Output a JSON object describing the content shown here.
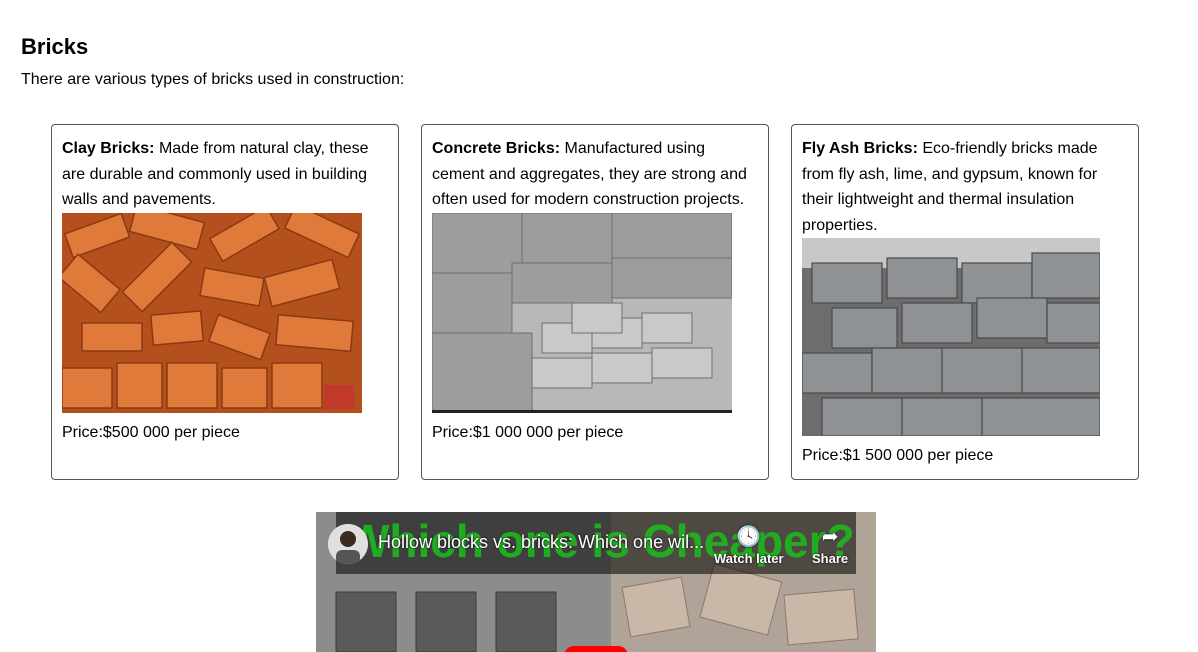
{
  "section": {
    "title": "Bricks",
    "intro": "There are various types of bricks used in construction:"
  },
  "cards": [
    {
      "name": "Clay Bricks:",
      "description": " Made from natural clay, these are durable and commonly used in building walls and pavements.",
      "price": "Price:$500 000 per piece",
      "image": "clay-bricks-photo"
    },
    {
      "name": "Concrete Bricks:",
      "description": " Manufactured using cement and aggregates, they are strong and often used for modern construction projects.",
      "price": "Price:$1 000 000 per piece",
      "image": "concrete-blocks-photo"
    },
    {
      "name": "Fly Ash Bricks:",
      "description": " Eco-friendly bricks made from fly ash, lime, and gypsum, known for their lightweight and thermal insulation properties.",
      "price": "Price:$1 500 000 per piece",
      "image": "fly-ash-bricks-photo"
    }
  ],
  "video": {
    "title": "Hollow blocks vs. bricks: Which one wil...",
    "overlay_text": "Which one is Cheaper?",
    "watch_later_label": "Watch later",
    "share_label": "Share"
  },
  "colors": {
    "brick": "#d9692a",
    "concrete": "#8a8a8a",
    "overlay_green": "#1bbf1b",
    "play_red": "#ff0000"
  }
}
